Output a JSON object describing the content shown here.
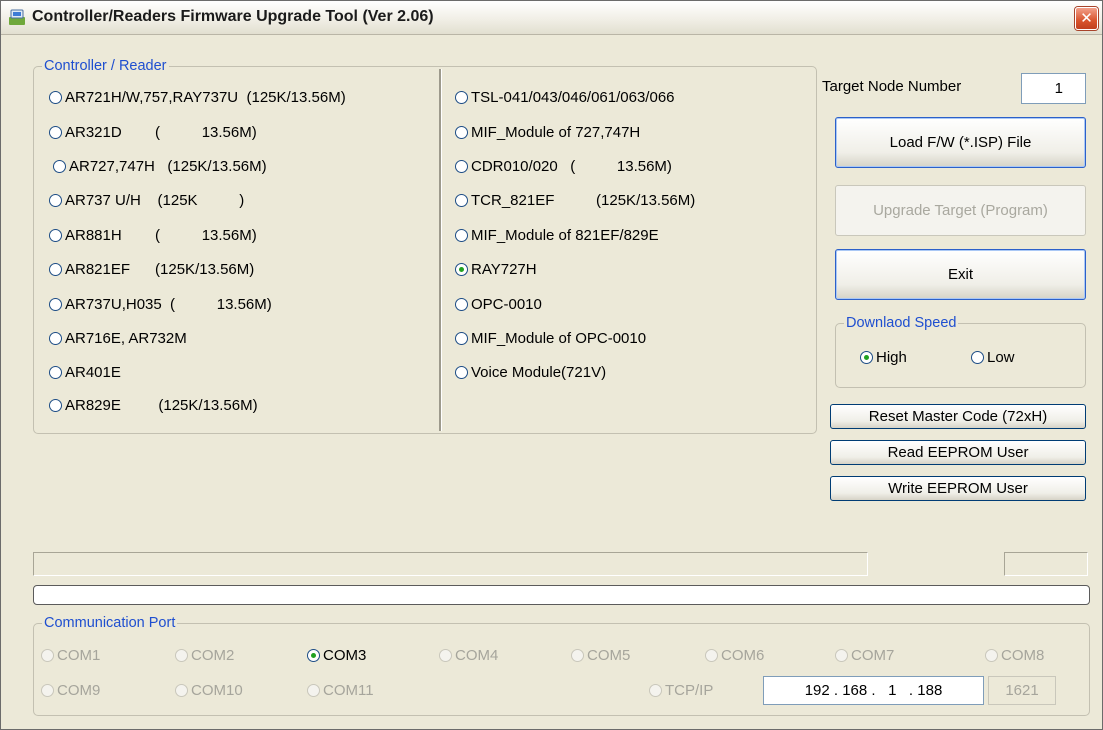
{
  "window": {
    "title": "Controller/Readers Firmware Upgrade Tool  (Ver 2.06)",
    "close_glyph": "✕"
  },
  "reader_group": {
    "legend": "Controller / Reader",
    "left_options": [
      "AR721H/W,757,RAY737U  (125K/13.56M)",
      "AR321D        (          13.56M)",
      "AR727,747H   (125K/13.56M)",
      "AR737 U/H    (125K          )",
      "AR881H        (          13.56M)",
      "AR821EF      (125K/13.56M)",
      "AR737U,H035  (          13.56M)",
      "AR716E, AR732M",
      "AR401E",
      "AR829E         (125K/13.56M)"
    ],
    "right_options": [
      "TSL-041/043/046/061/063/066",
      "MIF_Module of 727,747H",
      "CDR010/020   (          13.56M)",
      "TCR_821EF          (125K/13.56M)",
      "MIF_Module of 821EF/829E",
      "RAY727H",
      "OPC-0010",
      "MIF_Module of OPC-0010",
      "Voice Module(721V)"
    ],
    "selected": "RAY727H"
  },
  "target_node": {
    "label": "Target Node Number",
    "value": "1"
  },
  "buttons": {
    "load": "Load  F/W (*.ISP)  File",
    "upgrade": "Upgrade Target  (Program)",
    "exit": "Exit",
    "reset": "Reset Master Code  (72xH)",
    "read": "Read EEPROM User",
    "write": "Write EEPROM User"
  },
  "speed_group": {
    "legend": "Downlaod Speed",
    "high": "High",
    "low": "Low",
    "selected": "High"
  },
  "comm_group": {
    "legend": "Communication Port",
    "ports_row1": [
      "COM1",
      "COM2",
      "COM3",
      "COM4",
      "COM5",
      "COM6",
      "COM7",
      "COM8"
    ],
    "ports_row2": [
      "COM9",
      "COM10",
      "COM11"
    ],
    "selected": "COM3",
    "tcpip_label": "TCP/IP",
    "ip_value": "192 . 168 .   1   . 188",
    "port_value": "1621"
  },
  "colors": {
    "legend": "#1f4fd0",
    "radio_dot": "#21a121",
    "face": "#ece9d8"
  }
}
